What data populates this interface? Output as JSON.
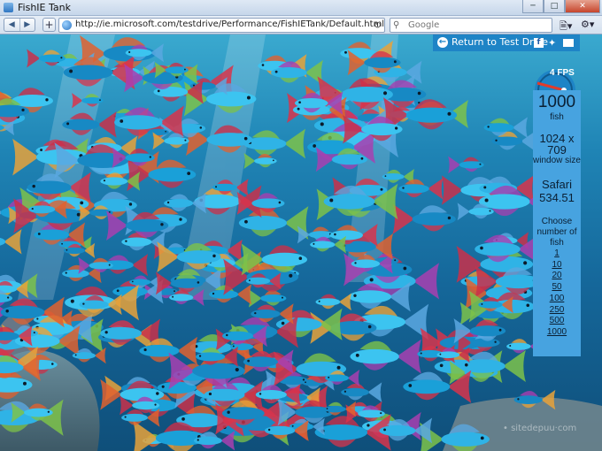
{
  "window": {
    "title": "FishIE Tank"
  },
  "toolbar": {
    "url": "http://ie.microsoft.com/testdrive/Performance/FishIETank/Default.html",
    "search_placeholder": "Google"
  },
  "banner": {
    "return_label": "Return to Test Drive"
  },
  "stats": {
    "fps_label": "4 FPS",
    "fish_count": "1000",
    "fish_label": "fish",
    "window_size": "1024 x 709",
    "window_size_label": "window size",
    "browser_name": "Safari",
    "browser_version": "534.51",
    "choose_label": "Choose number of fish",
    "options": [
      "1",
      "10",
      "20",
      "50",
      "100",
      "250",
      "500",
      "1000"
    ]
  },
  "watermark": "• sitedepuu·com",
  "icons": [
    "app-icon",
    "back-icon",
    "forward-icon",
    "new-tab-icon",
    "globe-icon",
    "reload-icon",
    "search-icon",
    "page-menu-icon",
    "tools-menu-icon",
    "return-arrow-icon",
    "facebook-icon",
    "twitter-icon",
    "email-icon",
    "fps-gauge-icon"
  ],
  "colors": {
    "panel": "#47a3e0",
    "banner": "#1e84c6",
    "water": "#1f84b5",
    "gauge_needle": "#e23b2a"
  }
}
